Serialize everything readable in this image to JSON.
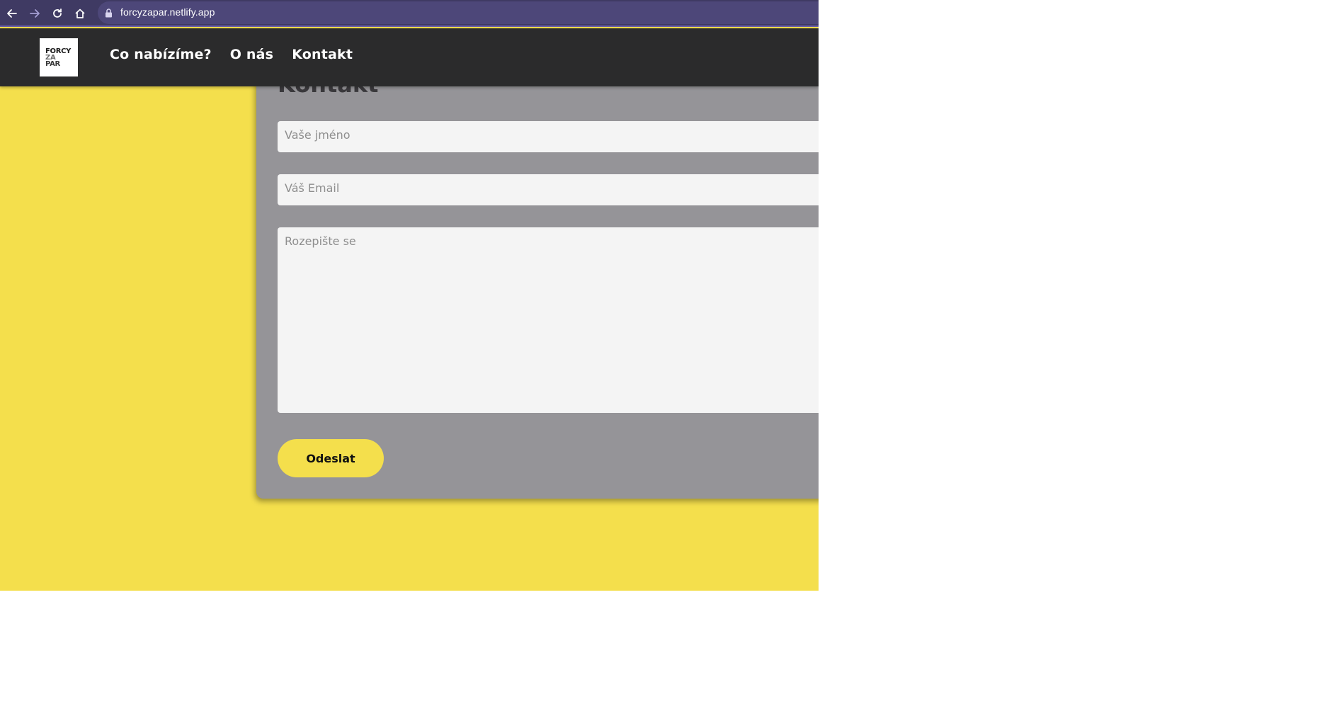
{
  "browser": {
    "url": "forcyzapar.netlify.app",
    "icons": [
      "back-arrow-icon",
      "forward-arrow-icon",
      "reload-icon",
      "home-icon",
      "lock-icon"
    ]
  },
  "header": {
    "logo": {
      "line1": "FORCY",
      "line2": "ZA",
      "line3": "PAR"
    },
    "nav": [
      {
        "label": "Co nabízíme?"
      },
      {
        "label": "O nás"
      },
      {
        "label": "Kontakt"
      }
    ]
  },
  "contact": {
    "title": "Kontakt",
    "name_placeholder": "Vaše jméno",
    "email_placeholder": "Váš Email",
    "message_placeholder": "Rozepište se",
    "submit_label": "Odeslat"
  },
  "colors": {
    "background": "#f4df4c",
    "card": "#959498",
    "nav": "#2b2b2c",
    "browser_bar": "#3f3a63"
  }
}
